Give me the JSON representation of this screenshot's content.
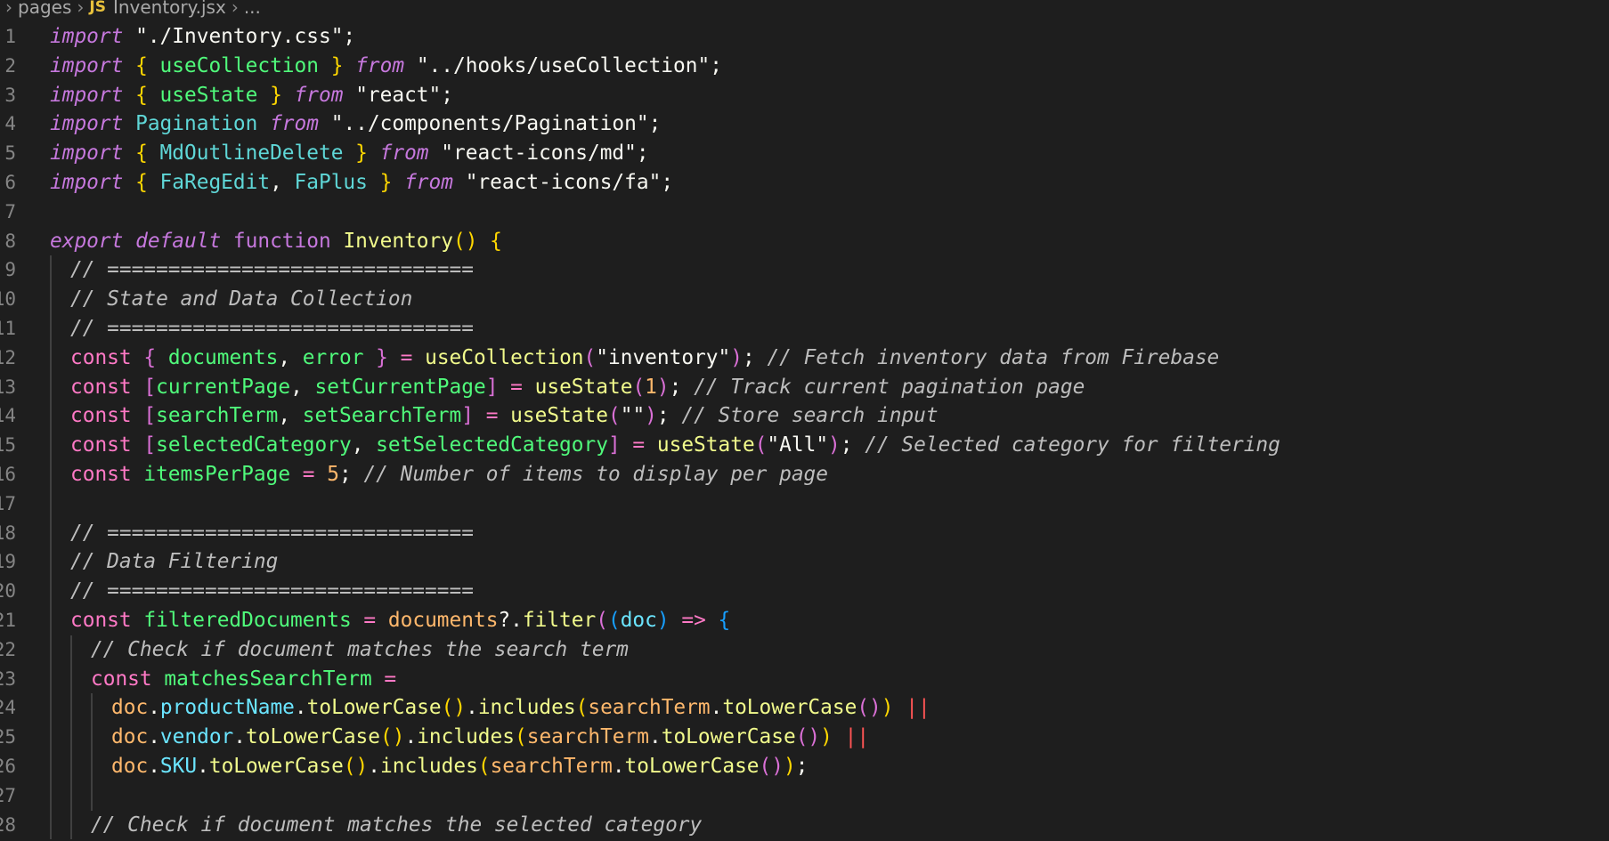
{
  "breadcrumb": {
    "folder": "pages",
    "file_icon": "JS",
    "file": "Inventory.jsx",
    "trail": "..."
  },
  "colors": {
    "background": "#1e1e1e",
    "line_number": "#858585",
    "keyword": "#c678dd",
    "string": "#f8f8f2",
    "comment": "#bdbdbd",
    "function": "#f1fa8c",
    "identifier": "#50fa7b",
    "variable": "#ffb86c",
    "operator": "#ff79c6",
    "bracket_1": "#ffd700",
    "bracket_2": "#da70d6",
    "bracket_3": "#179fff"
  },
  "lines": [
    {
      "n": "1",
      "indent": 0,
      "tokens": [
        [
          "import",
          "kw"
        ],
        [
          " ",
          "pun"
        ],
        [
          "\"./Inventory.css\"",
          "str"
        ],
        [
          ";",
          "pun"
        ]
      ]
    },
    {
      "n": "2",
      "indent": 0,
      "tokens": [
        [
          "import",
          "kw"
        ],
        [
          " ",
          "pun"
        ],
        [
          "{",
          "b1"
        ],
        [
          " useCollection ",
          "id"
        ],
        [
          "}",
          "b1"
        ],
        [
          " ",
          "pun"
        ],
        [
          "from",
          "kw"
        ],
        [
          " ",
          "pun"
        ],
        [
          "\"../hooks/useCollection\"",
          "str"
        ],
        [
          ";",
          "pun"
        ]
      ]
    },
    {
      "n": "3",
      "indent": 0,
      "tokens": [
        [
          "import",
          "kw"
        ],
        [
          " ",
          "pun"
        ],
        [
          "{",
          "b1"
        ],
        [
          " useState ",
          "id"
        ],
        [
          "}",
          "b1"
        ],
        [
          " ",
          "pun"
        ],
        [
          "from",
          "kw"
        ],
        [
          " ",
          "pun"
        ],
        [
          "\"react\"",
          "str"
        ],
        [
          ";",
          "pun"
        ]
      ]
    },
    {
      "n": "4",
      "indent": 0,
      "tokens": [
        [
          "import",
          "kw"
        ],
        [
          " ",
          "pun"
        ],
        [
          "Pagination",
          "idc"
        ],
        [
          " ",
          "pun"
        ],
        [
          "from",
          "kw"
        ],
        [
          " ",
          "pun"
        ],
        [
          "\"../components/Pagination\"",
          "str"
        ],
        [
          ";",
          "pun"
        ]
      ]
    },
    {
      "n": "5",
      "indent": 0,
      "tokens": [
        [
          "import",
          "kw"
        ],
        [
          " ",
          "pun"
        ],
        [
          "{",
          "b1"
        ],
        [
          " MdOutlineDelete ",
          "idc"
        ],
        [
          "}",
          "b1"
        ],
        [
          " ",
          "pun"
        ],
        [
          "from",
          "kw"
        ],
        [
          " ",
          "pun"
        ],
        [
          "\"react-icons/md\"",
          "str"
        ],
        [
          ";",
          "pun"
        ]
      ]
    },
    {
      "n": "6",
      "indent": 0,
      "tokens": [
        [
          "import",
          "kw"
        ],
        [
          " ",
          "pun"
        ],
        [
          "{",
          "b1"
        ],
        [
          " FaRegEdit",
          "idc"
        ],
        [
          ", ",
          "pun"
        ],
        [
          "FaPlus ",
          "idc"
        ],
        [
          "}",
          "b1"
        ],
        [
          " ",
          "pun"
        ],
        [
          "from",
          "kw"
        ],
        [
          " ",
          "pun"
        ],
        [
          "\"react-icons/fa\"",
          "str"
        ],
        [
          ";",
          "pun"
        ]
      ]
    },
    {
      "n": "7",
      "indent": 0,
      "tokens": []
    },
    {
      "n": "8",
      "indent": 0,
      "tokens": [
        [
          "export",
          "kw"
        ],
        [
          " ",
          "pun"
        ],
        [
          "default",
          "kw"
        ],
        [
          " ",
          "pun"
        ],
        [
          "function",
          "kw2"
        ],
        [
          " ",
          "pun"
        ],
        [
          "Inventory",
          "fn"
        ],
        [
          "()",
          "b1"
        ],
        [
          " ",
          "pun"
        ],
        [
          "{",
          "b1"
        ]
      ]
    },
    {
      "n": "9",
      "indent": 1,
      "tokens": [
        [
          "// ==============================",
          "cm"
        ]
      ]
    },
    {
      "n": "10",
      "indent": 1,
      "tokens": [
        [
          "// State and Data Collection",
          "cm"
        ]
      ]
    },
    {
      "n": "11",
      "indent": 1,
      "tokens": [
        [
          "// ==============================",
          "cm"
        ]
      ]
    },
    {
      "n": "12",
      "indent": 1,
      "tokens": [
        [
          "const",
          "const"
        ],
        [
          " ",
          "pun"
        ],
        [
          "{",
          "b2"
        ],
        [
          " documents",
          "id"
        ],
        [
          ", ",
          "pun"
        ],
        [
          "error ",
          "id"
        ],
        [
          "}",
          "b2"
        ],
        [
          " ",
          "pun"
        ],
        [
          "=",
          "op"
        ],
        [
          " ",
          "pun"
        ],
        [
          "useCollection",
          "fn"
        ],
        [
          "(",
          "b2"
        ],
        [
          "\"inventory\"",
          "str"
        ],
        [
          ")",
          "b2"
        ],
        [
          ";",
          "pun"
        ],
        [
          " // Fetch inventory data from Firebase",
          "cm"
        ]
      ]
    },
    {
      "n": "13",
      "indent": 1,
      "tokens": [
        [
          "const",
          "const"
        ],
        [
          " ",
          "pun"
        ],
        [
          "[",
          "b2"
        ],
        [
          "currentPage",
          "id"
        ],
        [
          ", ",
          "pun"
        ],
        [
          "setCurrentPage",
          "id"
        ],
        [
          "]",
          "b2"
        ],
        [
          " ",
          "pun"
        ],
        [
          "=",
          "op"
        ],
        [
          " ",
          "pun"
        ],
        [
          "useState",
          "fn"
        ],
        [
          "(",
          "b2"
        ],
        [
          "1",
          "num"
        ],
        [
          ")",
          "b2"
        ],
        [
          ";",
          "pun"
        ],
        [
          " // Track current pagination page",
          "cm"
        ]
      ]
    },
    {
      "n": "14",
      "indent": 1,
      "tokens": [
        [
          "const",
          "const"
        ],
        [
          " ",
          "pun"
        ],
        [
          "[",
          "b2"
        ],
        [
          "searchTerm",
          "id"
        ],
        [
          ", ",
          "pun"
        ],
        [
          "setSearchTerm",
          "id"
        ],
        [
          "]",
          "b2"
        ],
        [
          " ",
          "pun"
        ],
        [
          "=",
          "op"
        ],
        [
          " ",
          "pun"
        ],
        [
          "useState",
          "fn"
        ],
        [
          "(",
          "b2"
        ],
        [
          "\"\"",
          "str"
        ],
        [
          ")",
          "b2"
        ],
        [
          ";",
          "pun"
        ],
        [
          " // Store search input",
          "cm"
        ]
      ]
    },
    {
      "n": "15",
      "indent": 1,
      "tokens": [
        [
          "const",
          "const"
        ],
        [
          " ",
          "pun"
        ],
        [
          "[",
          "b2"
        ],
        [
          "selectedCategory",
          "id"
        ],
        [
          ", ",
          "pun"
        ],
        [
          "setSelectedCategory",
          "id"
        ],
        [
          "]",
          "b2"
        ],
        [
          " ",
          "pun"
        ],
        [
          "=",
          "op"
        ],
        [
          " ",
          "pun"
        ],
        [
          "useState",
          "fn"
        ],
        [
          "(",
          "b2"
        ],
        [
          "\"All\"",
          "str"
        ],
        [
          ")",
          "b2"
        ],
        [
          ";",
          "pun"
        ],
        [
          " // Selected category for filtering",
          "cm"
        ]
      ]
    },
    {
      "n": "16",
      "indent": 1,
      "tokens": [
        [
          "const",
          "const"
        ],
        [
          " ",
          "pun"
        ],
        [
          "itemsPerPage",
          "id"
        ],
        [
          " ",
          "pun"
        ],
        [
          "=",
          "op"
        ],
        [
          " ",
          "pun"
        ],
        [
          "5",
          "num"
        ],
        [
          ";",
          "pun"
        ],
        [
          " // Number of items to display per page",
          "cm"
        ]
      ]
    },
    {
      "n": "17",
      "indent": 1,
      "tokens": []
    },
    {
      "n": "18",
      "indent": 1,
      "tokens": [
        [
          "// ==============================",
          "cm"
        ]
      ]
    },
    {
      "n": "19",
      "indent": 1,
      "tokens": [
        [
          "// Data Filtering",
          "cm"
        ]
      ]
    },
    {
      "n": "20",
      "indent": 1,
      "tokens": [
        [
          "// ==============================",
          "cm"
        ]
      ]
    },
    {
      "n": "21",
      "indent": 1,
      "tokens": [
        [
          "const",
          "const"
        ],
        [
          " ",
          "pun"
        ],
        [
          "filteredDocuments",
          "id"
        ],
        [
          " ",
          "pun"
        ],
        [
          "=",
          "op"
        ],
        [
          " ",
          "pun"
        ],
        [
          "documents",
          "var"
        ],
        [
          "?.",
          "pun"
        ],
        [
          "filter",
          "fn"
        ],
        [
          "(",
          "b2"
        ],
        [
          "(",
          "b3"
        ],
        [
          "doc",
          "prop"
        ],
        [
          ")",
          "b3"
        ],
        [
          " ",
          "pun"
        ],
        [
          "=>",
          "op"
        ],
        [
          " ",
          "pun"
        ],
        [
          "{",
          "b3"
        ]
      ]
    },
    {
      "n": "22",
      "indent": 2,
      "tokens": [
        [
          "// Check if document matches the search term",
          "cm"
        ]
      ]
    },
    {
      "n": "23",
      "indent": 2,
      "tokens": [
        [
          "const",
          "const"
        ],
        [
          " ",
          "pun"
        ],
        [
          "matchesSearchTerm",
          "id"
        ],
        [
          " ",
          "pun"
        ],
        [
          "=",
          "op"
        ]
      ]
    },
    {
      "n": "24",
      "indent": 3,
      "tokens": [
        [
          "doc",
          "var"
        ],
        [
          ".",
          "pun"
        ],
        [
          "productName",
          "prop"
        ],
        [
          ".",
          "pun"
        ],
        [
          "toLowerCase",
          "fn"
        ],
        [
          "()",
          "b1"
        ],
        [
          ".",
          "pun"
        ],
        [
          "includes",
          "fn"
        ],
        [
          "(",
          "b1"
        ],
        [
          "searchTerm",
          "var"
        ],
        [
          ".",
          "pun"
        ],
        [
          "toLowerCase",
          "fn"
        ],
        [
          "()",
          "b2"
        ],
        [
          ")",
          "b1"
        ],
        [
          " ",
          "pun"
        ],
        [
          "||",
          "or"
        ]
      ]
    },
    {
      "n": "25",
      "indent": 3,
      "tokens": [
        [
          "doc",
          "var"
        ],
        [
          ".",
          "pun"
        ],
        [
          "vendor",
          "prop"
        ],
        [
          ".",
          "pun"
        ],
        [
          "toLowerCase",
          "fn"
        ],
        [
          "()",
          "b1"
        ],
        [
          ".",
          "pun"
        ],
        [
          "includes",
          "fn"
        ],
        [
          "(",
          "b1"
        ],
        [
          "searchTerm",
          "var"
        ],
        [
          ".",
          "pun"
        ],
        [
          "toLowerCase",
          "fn"
        ],
        [
          "()",
          "b2"
        ],
        [
          ")",
          "b1"
        ],
        [
          " ",
          "pun"
        ],
        [
          "||",
          "or"
        ]
      ]
    },
    {
      "n": "26",
      "indent": 3,
      "tokens": [
        [
          "doc",
          "var"
        ],
        [
          ".",
          "pun"
        ],
        [
          "SKU",
          "prop"
        ],
        [
          ".",
          "pun"
        ],
        [
          "toLowerCase",
          "fn"
        ],
        [
          "()",
          "b1"
        ],
        [
          ".",
          "pun"
        ],
        [
          "includes",
          "fn"
        ],
        [
          "(",
          "b1"
        ],
        [
          "searchTerm",
          "var"
        ],
        [
          ".",
          "pun"
        ],
        [
          "toLowerCase",
          "fn"
        ],
        [
          "()",
          "b2"
        ],
        [
          ")",
          "b1"
        ],
        [
          ";",
          "pun"
        ]
      ]
    },
    {
      "n": "27",
      "indent": 3,
      "tokens": []
    },
    {
      "n": "28",
      "indent": 2,
      "tokens": [
        [
          "// Check if document matches the selected category",
          "cm"
        ]
      ]
    }
  ]
}
